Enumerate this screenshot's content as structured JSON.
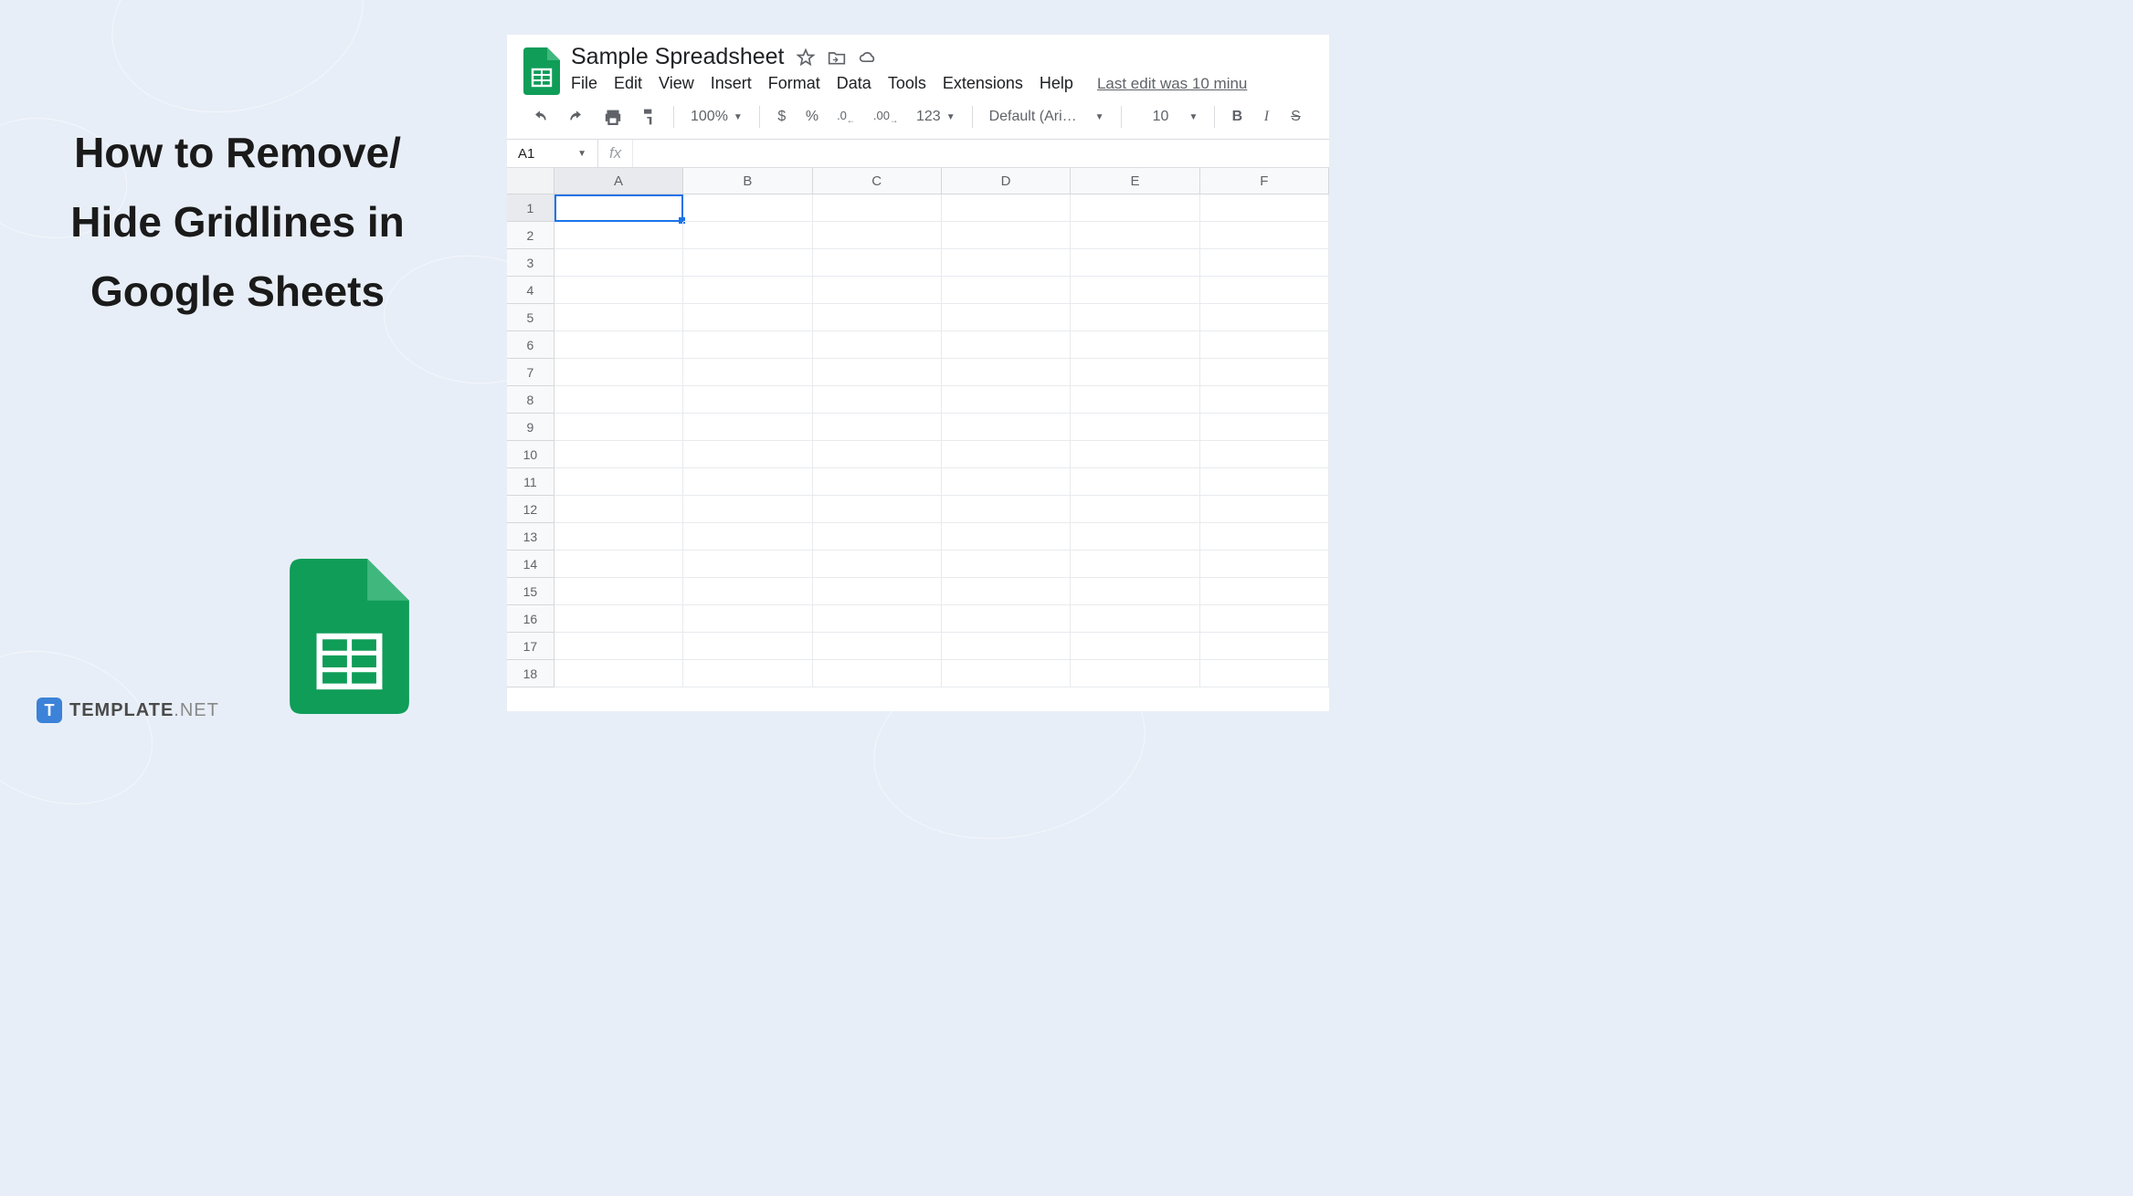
{
  "left": {
    "heading": "How to Remove/ Hide Gridlines in Google Sheets",
    "brand_name": "TEMPLATE",
    "brand_suffix": ".NET"
  },
  "sheets": {
    "doc_title": "Sample Spreadsheet",
    "menu": {
      "file": "File",
      "edit": "Edit",
      "view": "View",
      "insert": "Insert",
      "format": "Format",
      "data": "Data",
      "tools": "Tools",
      "extensions": "Extensions",
      "help": "Help"
    },
    "last_edit": "Last edit was 10 minu",
    "toolbar": {
      "zoom": "100%",
      "currency": "$",
      "percent": "%",
      "dec_decrease": ".0",
      "dec_increase": ".00",
      "format_123": "123",
      "font_name": "Default (Ari…",
      "font_size": "10",
      "bold": "B",
      "italic": "I",
      "strike": "S"
    },
    "formula": {
      "name_box": "A1",
      "fx": "fx"
    },
    "columns": [
      "A",
      "B",
      "C",
      "D",
      "E",
      "F"
    ],
    "rows": [
      "1",
      "2",
      "3",
      "4",
      "5",
      "6",
      "7",
      "8",
      "9",
      "10",
      "11",
      "12",
      "13",
      "14",
      "15",
      "16",
      "17",
      "18"
    ],
    "selected_cell": "A1"
  }
}
